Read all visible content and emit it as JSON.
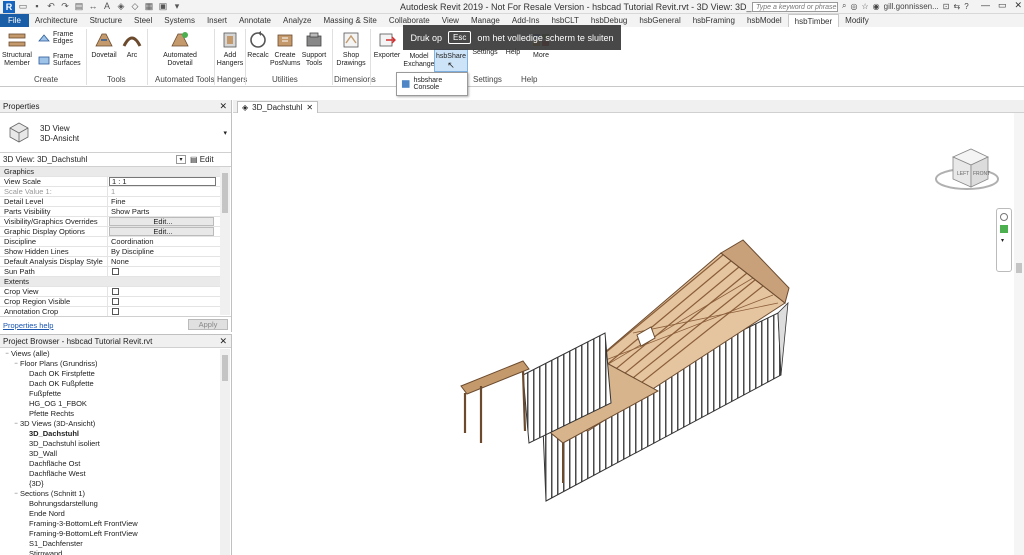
{
  "window": {
    "title": "Autodesk Revit 2019 - Not For Resale Version - hsbcad Tutorial Revit.rvt - 3D View: 3D_Dachstuhl",
    "search_placeholder": "Type a keyword or phrase",
    "user": "gill.gonnissen..."
  },
  "ribbon_tabs": [
    "File",
    "Architecture",
    "Structure",
    "Steel",
    "Systems",
    "Insert",
    "Annotate",
    "Analyze",
    "Massing & Site",
    "Collaborate",
    "View",
    "Manage",
    "Add-Ins",
    "hsbCLT",
    "hsbDebug",
    "hsbGeneral",
    "hsbFraming",
    "hsbModel",
    "hsbTimber",
    "Modify"
  ],
  "active_tab": "hsbTimber",
  "ribbon": {
    "create": {
      "label": "Create",
      "structural_member": "Structural Member",
      "frame_edges": "Frame Edges",
      "frame_surfaces": "Frame Surfaces"
    },
    "tools": {
      "label": "Tools",
      "dovetail": "Dovetail",
      "arc": "Arc"
    },
    "automated_tools": {
      "label": "Automated Tools",
      "automated_dovetail": "Automated Dovetail"
    },
    "hangers": {
      "label": "Hangers",
      "add_hangers": "Add Hangers"
    },
    "utilities": {
      "label": "Utilities",
      "recalc": "Recalc",
      "create_posnums": "Create PosNums",
      "support_tools": "Support Tools"
    },
    "dimensions": {
      "label": "Dimensions",
      "shop_drawings": "Shop Drawings"
    },
    "exporter": {
      "label": "Exporter"
    },
    "model_exchange": {
      "label": "Model Exchange"
    },
    "hsbshare": {
      "label": "hsbShare"
    },
    "settings": {
      "label": "Settings",
      "button": "Settings"
    },
    "help": {
      "label": "Help",
      "button": "Help"
    },
    "more": {
      "label": "More"
    }
  },
  "fullscreen_overlay": {
    "pre": "Druk op",
    "key": "Esc",
    "post": "om het volledige scherm te sluiten"
  },
  "dropdown": {
    "item": "hsbshare Console"
  },
  "properties": {
    "title": "Properties",
    "type_line1": "3D View",
    "type_line2": "3D-Ansicht",
    "view_selector": "3D View: 3D_Dachstuhl",
    "edit_type": "Edit Type",
    "rows": [
      {
        "k": "Graphics",
        "v": "",
        "kind": "section"
      },
      {
        "k": "View Scale",
        "v": "1 : 1",
        "kind": "boxed"
      },
      {
        "k": "Scale Value    1:",
        "v": "1",
        "kind": "grey"
      },
      {
        "k": "Detail Level",
        "v": "Fine",
        "kind": "text"
      },
      {
        "k": "Parts Visibility",
        "v": "Show Parts",
        "kind": "text"
      },
      {
        "k": "Visibility/Graphics Overrides",
        "v": "Edit...",
        "kind": "btn"
      },
      {
        "k": "Graphic Display Options",
        "v": "Edit...",
        "kind": "btn"
      },
      {
        "k": "Discipline",
        "v": "Coordination",
        "kind": "text"
      },
      {
        "k": "Show Hidden Lines",
        "v": "By Discipline",
        "kind": "text"
      },
      {
        "k": "Default Analysis Display Style",
        "v": "None",
        "kind": "text"
      },
      {
        "k": "Sun Path",
        "v": "",
        "kind": "check"
      },
      {
        "k": "Extents",
        "v": "",
        "kind": "section"
      },
      {
        "k": "Crop View",
        "v": "",
        "kind": "check"
      },
      {
        "k": "Crop Region Visible",
        "v": "",
        "kind": "check"
      },
      {
        "k": "Annotation Crop",
        "v": "",
        "kind": "check"
      }
    ],
    "help_link": "Properties help",
    "apply": "Apply"
  },
  "project_browser": {
    "title": "Project Browser - hsbcad Tutorial Revit.rvt",
    "items": [
      {
        "label": "Views (alle)",
        "level": 0,
        "twig": "−"
      },
      {
        "label": "Floor Plans (Grundriss)",
        "level": 1,
        "twig": "−"
      },
      {
        "label": "Dach OK Firstpfette",
        "level": 2,
        "twig": ""
      },
      {
        "label": "Dach OK Fußpfette",
        "level": 2,
        "twig": ""
      },
      {
        "label": "Fußpfette",
        "level": 2,
        "twig": ""
      },
      {
        "label": "HG_OG 1_FBOK",
        "level": 2,
        "twig": ""
      },
      {
        "label": "Pfette Rechts",
        "level": 2,
        "twig": ""
      },
      {
        "label": "3D Views (3D-Ansicht)",
        "level": 1,
        "twig": "−"
      },
      {
        "label": "3D_Dachstuhl",
        "level": 2,
        "twig": "",
        "bold": true
      },
      {
        "label": "3D_Dachstuhl isoliert",
        "level": 2,
        "twig": ""
      },
      {
        "label": "3D_Wall",
        "level": 2,
        "twig": ""
      },
      {
        "label": "Dachfläche Ost",
        "level": 2,
        "twig": ""
      },
      {
        "label": "Dachfläche West",
        "level": 2,
        "twig": ""
      },
      {
        "label": "{3D}",
        "level": 2,
        "twig": ""
      },
      {
        "label": "Sections (Schnitt 1)",
        "level": 1,
        "twig": "−"
      },
      {
        "label": "Bohrungsdarstellung",
        "level": 2,
        "twig": ""
      },
      {
        "label": "Ende Nord",
        "level": 2,
        "twig": ""
      },
      {
        "label": "Framing-3-BottomLeft FrontView",
        "level": 2,
        "twig": ""
      },
      {
        "label": "Framing-9-BottomLeft FrontView",
        "level": 2,
        "twig": ""
      },
      {
        "label": "S1_Dachfenster",
        "level": 2,
        "twig": ""
      },
      {
        "label": "Stirnwand",
        "level": 2,
        "twig": ""
      }
    ]
  },
  "view_tab": {
    "label": "3D_Dachstuhl"
  },
  "viewcube": {
    "left": "LEFT",
    "front": "FRONT"
  },
  "colors": {
    "file_tab": "#1a5ea8",
    "timber": "#c49a6c",
    "timber_dark": "#6b4a2e",
    "hsbshare_active": "#cde3f7"
  }
}
